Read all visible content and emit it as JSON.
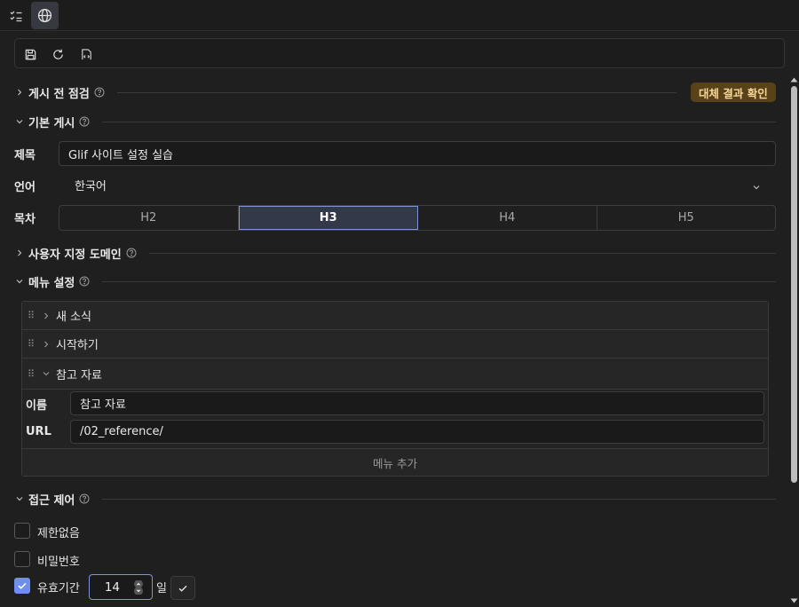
{
  "topbar": {
    "tabs": [
      {
        "icon": "checklist-icon"
      },
      {
        "icon": "globe-icon"
      }
    ]
  },
  "toolbar": {
    "icons": [
      "save-icon",
      "refresh-icon",
      "code-file-icon"
    ]
  },
  "sections": {
    "precheck": {
      "title": "게시 전 점검",
      "badge": "대체 결과 확인"
    },
    "basic": {
      "title": "기본 게시"
    },
    "domain": {
      "title": "사용자 지정 도메인"
    },
    "menu": {
      "title": "메뉴 설정"
    },
    "access": {
      "title": "접근 제어"
    }
  },
  "fields": {
    "title_label": "제목",
    "title_value": "Glif 사이트 설정 실습",
    "lang_label": "언어",
    "lang_value": "한국어",
    "toc_label": "목차",
    "toc_options": [
      "H2",
      "H3",
      "H4",
      "H5"
    ],
    "toc_selected": "H3"
  },
  "menu": {
    "items": [
      {
        "label": "새 소식",
        "expanded": false
      },
      {
        "label": "시작하기",
        "expanded": false
      },
      {
        "label": "참고 자료",
        "expanded": true
      }
    ],
    "name_label": "이름",
    "name_value": "참고 자료",
    "url_label": "URL",
    "url_value": "/02_reference/",
    "add_label": "메뉴 추가"
  },
  "access": {
    "options": [
      {
        "label": "제한없음",
        "checked": false
      },
      {
        "label": "비밀번호",
        "checked": false
      },
      {
        "label": "유효기간",
        "checked": true
      }
    ],
    "days_value": "14",
    "days_unit": "일"
  },
  "colors": {
    "accent": "#6f8ef0",
    "badge_bg": "#5a4218",
    "badge_text": "#f4d79b"
  }
}
